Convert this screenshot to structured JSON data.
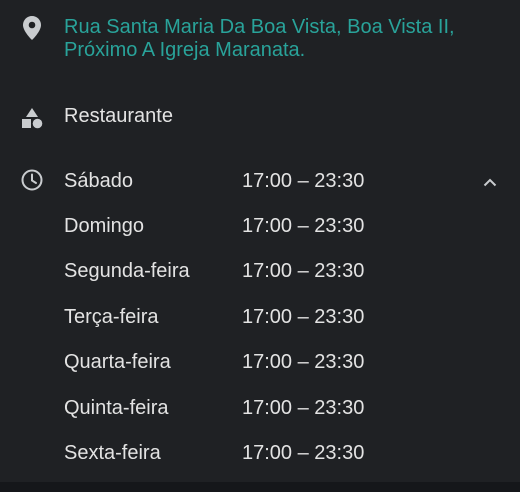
{
  "address": {
    "icon": "location-pin-icon",
    "text": "Rua Santa Maria Da Boa Vista, Boa Vista II, Próximo A Igreja Maranata."
  },
  "category": {
    "icon": "category-shapes-icon",
    "label": "Restaurante"
  },
  "hours": {
    "icon": "clock-icon",
    "collapse_icon": "chevron-up-icon",
    "rows": [
      {
        "day": "Sábado",
        "time": "17:00 – 23:30"
      },
      {
        "day": "Domingo",
        "time": "17:00 – 23:30"
      },
      {
        "day": "Segunda-feira",
        "time": "17:00 – 23:30"
      },
      {
        "day": "Terça-feira",
        "time": "17:00 – 23:30"
      },
      {
        "day": "Quarta-feira",
        "time": "17:00 – 23:30"
      },
      {
        "day": "Quinta-feira",
        "time": "17:00 – 23:30"
      },
      {
        "day": "Sexta-feira",
        "time": "17:00 – 23:30"
      }
    ]
  },
  "colors": {
    "background": "#1f2124",
    "address_accent": "#29a39a",
    "text": "#e3e3e3",
    "icon": "#c9cccf"
  }
}
